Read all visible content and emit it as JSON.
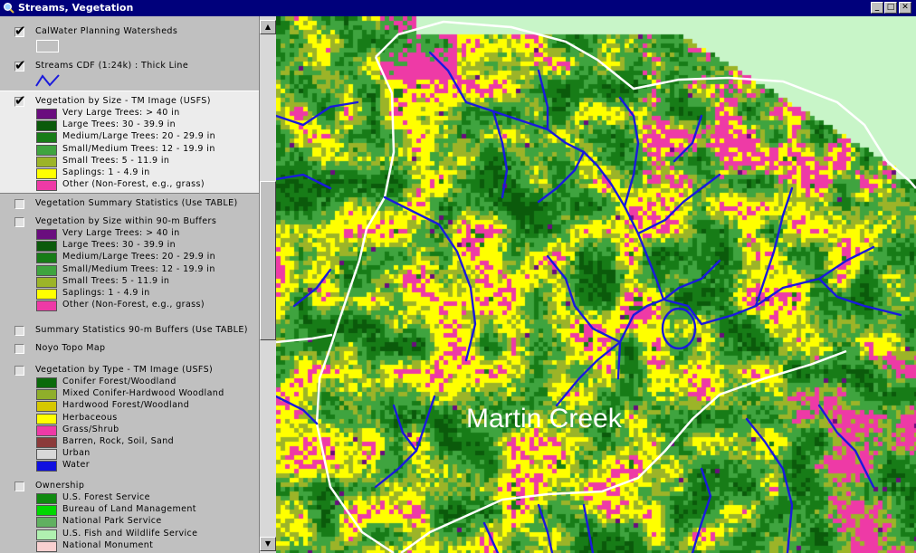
{
  "window": {
    "title": "Streams, Vegetation"
  },
  "toc": {
    "themes": [
      {
        "name": "CalWater Planning Watersheds",
        "checked": true,
        "symbol": "outline-rectangle-icon"
      },
      {
        "name": "Streams CDF (1:24k) : Thick Line",
        "checked": true,
        "symbol": "stream-line-icon"
      },
      {
        "name": "Vegetation by Size - TM Image (USFS)",
        "checked": true,
        "active": true,
        "classes": [
          {
            "label": "Very Large Trees: > 40  in",
            "color": "#6a0d7e"
          },
          {
            "label": "Large Trees: 30 - 39.9 in",
            "color": "#0b5a0b"
          },
          {
            "label": "Medium/Large Trees: 20 - 29.9 in",
            "color": "#177c17"
          },
          {
            "label": "Small/Medium Trees: 12 - 19.9 in",
            "color": "#3fa43f"
          },
          {
            "label": "Small Trees: 5 - 11.9 in",
            "color": "#9cb428"
          },
          {
            "label": "Saplings: 1 - 4.9 in",
            "color": "#ffff00"
          },
          {
            "label": "Other (Non-Forest, e.g., grass)",
            "color": "#ee3aa6"
          }
        ]
      },
      {
        "name": "Vegetation Summary Statistics (Use TABLE)",
        "checked": false
      },
      {
        "name": "Vegetation by Size within 90-m Buffers",
        "checked": false,
        "classes": [
          {
            "label": "Very Large Trees: > 40  in",
            "color": "#6a0d7e"
          },
          {
            "label": "Large Trees: 30 - 39.9 in",
            "color": "#0b5a0b"
          },
          {
            "label": "Medium/Large Trees: 20 - 29.9 in",
            "color": "#177c17"
          },
          {
            "label": "Small/Medium Trees: 12 - 19.9 in",
            "color": "#3fa43f"
          },
          {
            "label": "Small Trees: 5 - 11.9 in",
            "color": "#9cb428"
          },
          {
            "label": "Saplings: 1 - 4.9 in",
            "color": "#ffff00"
          },
          {
            "label": "Other (Non-Forest, e.g., grass)",
            "color": "#ee3aa6"
          }
        ]
      },
      {
        "name": "Summary Statistics 90-m Buffers (Use TABLE)",
        "checked": false
      },
      {
        "name": "Noyo Topo Map",
        "checked": false
      },
      {
        "name": "Vegetation by Type - TM Image (USFS)",
        "checked": false,
        "classes": [
          {
            "label": "Conifer Forest/Woodland",
            "color": "#0b6a0b"
          },
          {
            "label": "Mixed Conifer-Hardwood Woodland",
            "color": "#8fae2a"
          },
          {
            "label": "Hardwood Forest/Woodland",
            "color": "#d6c800"
          },
          {
            "label": "Herbaceous",
            "color": "#ffff00"
          },
          {
            "label": "Grass/Shrub",
            "color": "#ee3aa6"
          },
          {
            "label": "Barren, Rock, Soil, Sand",
            "color": "#8b3a3a"
          },
          {
            "label": "Urban",
            "color": "#d8d8d8"
          },
          {
            "label": "Water",
            "color": "#1010e0"
          }
        ]
      },
      {
        "name": "Ownership",
        "checked": false,
        "classes": [
          {
            "label": "U.S. Forest Service",
            "color": "#108a10"
          },
          {
            "label": "Bureau of Land Management",
            "color": "#00d800"
          },
          {
            "label": "National Park Service",
            "color": "#60b060"
          },
          {
            "label": "U.S. Fish and Wildlife Service",
            "color": "#b0f0b0"
          },
          {
            "label": "National Monument",
            "color": "#f8d0d0"
          }
        ]
      }
    ]
  },
  "map": {
    "label": "Martin Creek",
    "background_color": "#c8f5c8",
    "boundary_color": "#ffffff",
    "stream_color": "#1a1adc"
  }
}
